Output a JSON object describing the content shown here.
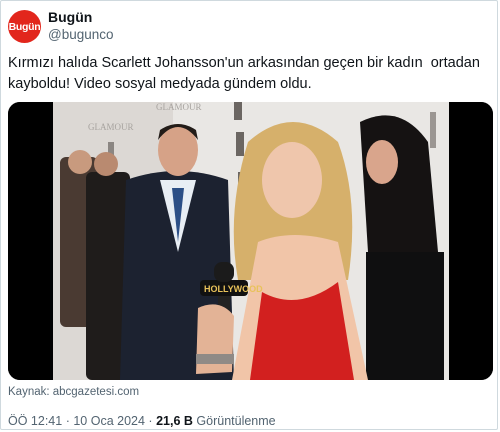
{
  "account": {
    "avatar_text": "Bugün",
    "avatar_color": "#e2261c",
    "display_name": "Bugün",
    "handle": "@bugunco"
  },
  "tweet": {
    "text": "Kırmızı halıda Scarlett Johansson'un arkasından geçen bir kadın  ortadan kayboldu! Video sosyal medyada gündem oldu.",
    "source": "Kaynak: abcgazetesi.com",
    "time": "ÖÖ 12:41",
    "separator": "·",
    "date": "10 Oca 2024",
    "views_count": "21,6 B",
    "views_label": "Görüntülenme"
  },
  "media": {
    "microphone_label": "HOLLYWOOD",
    "backdrop_text": "GLAMOUR"
  }
}
